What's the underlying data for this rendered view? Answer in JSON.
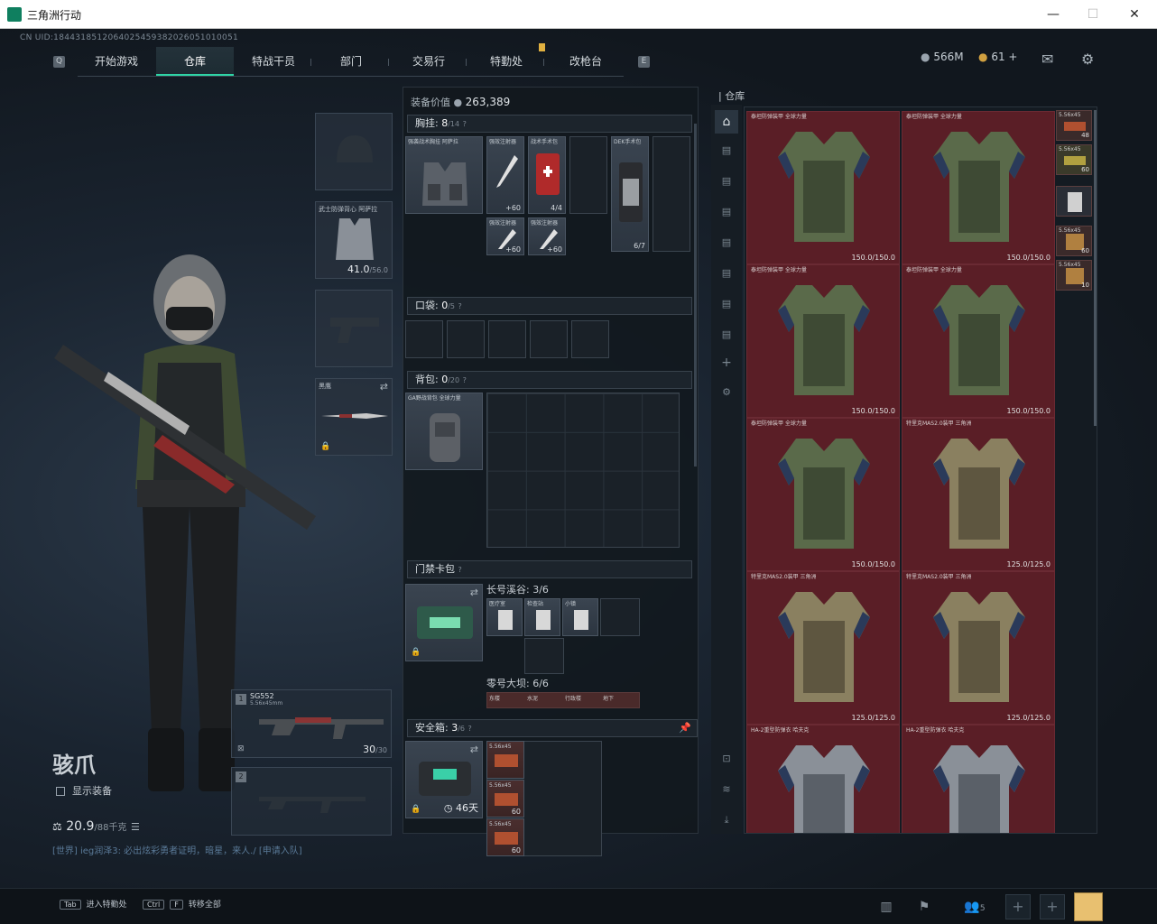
{
  "window": {
    "title": "三角洲行动",
    "minimize": "—",
    "maximize": "☐",
    "close": "✕"
  },
  "uid": "CN UID:1844318512064025459382026051010051",
  "nav": {
    "left_key": "Q",
    "right_key": "E",
    "tabs": [
      "开始游戏",
      "仓库",
      "特战干员",
      "部门",
      "交易行",
      "特勤处",
      "改枪台"
    ],
    "active": "仓库"
  },
  "currency": {
    "coins": "566M",
    "tokens": "61",
    "plus": "+"
  },
  "icons": {
    "mail": "mail-icon",
    "settings": "gear-icon"
  },
  "gear_slots": {
    "helmet": {
      "label": ""
    },
    "armor": {
      "label": "武士防弹背心 阿萨拉",
      "durability": "41.0",
      "max": "/56.0"
    },
    "pistol": {
      "label": ""
    },
    "melee": {
      "label": "黑鹰"
    }
  },
  "character": {
    "name": "骇爪",
    "show_gear": "显示装备",
    "weight": "20.9",
    "weight_max": "/88千克"
  },
  "chat": "[世界] ieg润泽3: 必出炫彩勇者证明，暗星，来人./ [申请入队]",
  "weapons": [
    {
      "slot": "1",
      "name": "SG552",
      "caliber": "5.56x45mm",
      "ammo": "30",
      "ammo_max": "/30"
    },
    {
      "slot": "2",
      "name": "",
      "caliber": "",
      "ammo": "",
      "ammo_max": ""
    }
  ],
  "equip_value": {
    "label": "装备价值",
    "value": "263,389"
  },
  "chest_rig": {
    "label": "胸挂:",
    "used": "8",
    "cap": "/14",
    "help": "?",
    "rig_name": "强袭战术胸挂 阿萨拉",
    "items": [
      {
        "name": "强效注射器",
        "count": "60"
      },
      {
        "name": "战术手术包",
        "count": "4/4"
      },
      {
        "name": "DEK手术包",
        "count": "6/7"
      },
      {
        "name": "强效注射器",
        "count": "60"
      },
      {
        "name": "强效注射器",
        "count": "60"
      }
    ]
  },
  "pocket": {
    "label": "口袋:",
    "used": "0",
    "cap": "/5",
    "help": "?"
  },
  "backpack": {
    "label": "背包:",
    "used": "0",
    "cap": "/20",
    "help": "?",
    "bag_name": "GA野战背包 全球力量"
  },
  "keycard": {
    "label": "门禁卡包",
    "help": "?",
    "group1": "长号溪谷: 3/6",
    "cards": [
      "医疗室",
      "检查站",
      "小镇"
    ],
    "group2": "零号大坝: 6/6",
    "cards2": [
      "东楼",
      "水泥",
      "行政楼",
      "地下"
    ]
  },
  "safebox": {
    "label": "安全箱:",
    "used": "3",
    "cap": "/6",
    "help": "?",
    "timer": "46天",
    "items": [
      {
        "name": "5.56x45",
        "count": ""
      },
      {
        "name": "5.56x45",
        "count": "60"
      },
      {
        "name": "5.56x45",
        "count": "60"
      }
    ]
  },
  "storage": {
    "title": "仓库",
    "armors": [
      {
        "name": "泰坦防弹装甲 全球力量",
        "dur": "150.0/150.0",
        "kind": "green"
      },
      {
        "name": "泰坦防弹装甲 全球力量",
        "dur": "150.0/150.0",
        "kind": "green"
      },
      {
        "name": "泰坦防弹装甲 全球力量",
        "dur": "150.0/150.0",
        "kind": "green"
      },
      {
        "name": "泰坦防弹装甲 全球力量",
        "dur": "150.0/150.0",
        "kind": "green"
      },
      {
        "name": "泰坦防弹装甲 全球力量",
        "dur": "150.0/150.0",
        "kind": "green"
      },
      {
        "name": "特里克MAS2.0装甲 三角洲",
        "dur": "125.0/125.0",
        "kind": "camo"
      },
      {
        "name": "特里克MAS2.0装甲 三角洲",
        "dur": "125.0/125.0",
        "kind": "camo"
      },
      {
        "name": "特里克MAS2.0装甲 三角洲",
        "dur": "125.0/125.0",
        "kind": "camo"
      },
      {
        "name": "HA-2重型防弹衣 哈夫克",
        "dur": "",
        "kind": "grey"
      },
      {
        "name": "HA-2重型防弹衣 哈夫克",
        "dur": "",
        "kind": "grey"
      }
    ],
    "side_items": [
      {
        "name": "5.56x45",
        "count": "48"
      },
      {
        "name": "5.56x45",
        "count": "60"
      },
      {
        "name": "",
        "count": ""
      },
      {
        "name": "5.56x45",
        "count": "60"
      },
      {
        "name": "5.56x45",
        "count": "10"
      }
    ]
  },
  "bottom": {
    "key1": "Tab",
    "action1": "进入特勤处",
    "key2": "Ctrl",
    "key2b": "F",
    "action2": "转移全部",
    "friends": "5"
  }
}
